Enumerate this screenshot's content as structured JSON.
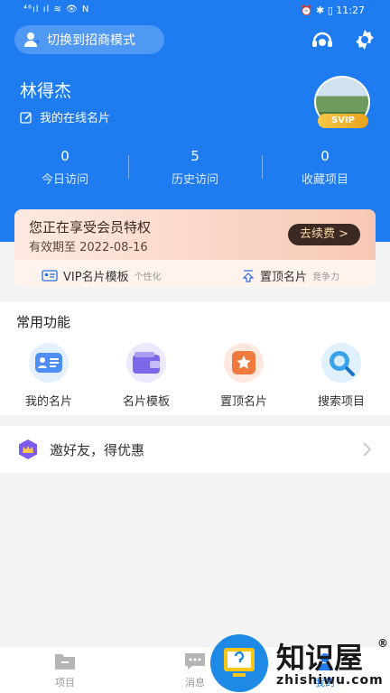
{
  "status_bar": {
    "left": "⁴⁶ıl ıl ≋ 👁 N",
    "right": "⏰ ✱ ▯ 11:27"
  },
  "header": {
    "switch_label": "切换到招商模式",
    "user_name": "林得杰",
    "online_card_label": "我的在线名片",
    "svip_badge": "SVIP"
  },
  "stats": [
    {
      "value": "0",
      "label": "今日访问"
    },
    {
      "value": "5",
      "label": "历史访问"
    },
    {
      "value": "0",
      "label": "收藏项目"
    }
  ],
  "vip": {
    "title": "您正在享受会员特权",
    "expiry": "有效期至 2022-08-16",
    "renew_label": "去续费 >",
    "features": [
      {
        "label": "VIP名片模板",
        "tag": "个性化"
      },
      {
        "label": "置顶名片",
        "tag": "竞争力"
      }
    ]
  },
  "common": {
    "title": "常用功能",
    "items": [
      {
        "label": "我的名片"
      },
      {
        "label": "名片模板"
      },
      {
        "label": "置顶名片"
      },
      {
        "label": "搜索项目"
      }
    ]
  },
  "invite": {
    "label": "邀好友，得优惠"
  },
  "tabs": [
    {
      "label": "项目"
    },
    {
      "label": "消息"
    },
    {
      "label": "我的"
    }
  ],
  "watermark": {
    "text": "知识屋",
    "domain": "zhishiwu.com",
    "mark": "®"
  },
  "colors": {
    "primary": "#1e7bf0",
    "vip_dark": "#3b2a24",
    "gold": "#f0b429"
  }
}
